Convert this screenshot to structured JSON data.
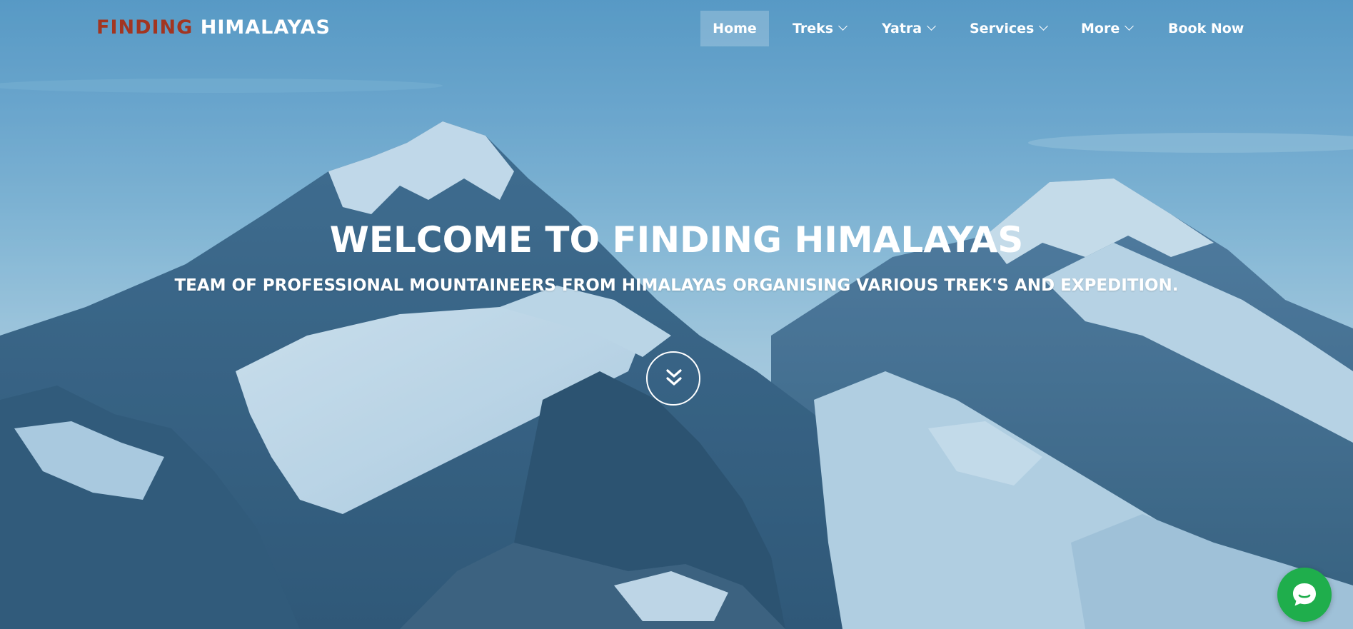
{
  "brand": {
    "part1": "FINDING",
    "part2": "HIMALAYAS",
    "accent_color": "#a23521"
  },
  "nav": {
    "items": [
      {
        "label": "Home",
        "active": true,
        "has_dropdown": false
      },
      {
        "label": "Treks",
        "active": false,
        "has_dropdown": true
      },
      {
        "label": "Yatra",
        "active": false,
        "has_dropdown": true
      },
      {
        "label": "Services",
        "active": false,
        "has_dropdown": true
      },
      {
        "label": "More",
        "active": false,
        "has_dropdown": true
      },
      {
        "label": "Book Now",
        "active": false,
        "has_dropdown": false
      }
    ]
  },
  "hero": {
    "title": "WELCOME TO FINDING HIMALAYAS",
    "subtitle": "TEAM OF PROFESSIONAL MOUNTAINEERS FROM HIMALAYAS ORGANISING VARIOUS TREK'S AND EXPEDITION.",
    "scroll_icon": "double-chevron-down-icon",
    "background": "snowy-mountain-range-photo"
  },
  "chat": {
    "icon": "chat-bubble-icon",
    "color": "#1fae4c"
  }
}
